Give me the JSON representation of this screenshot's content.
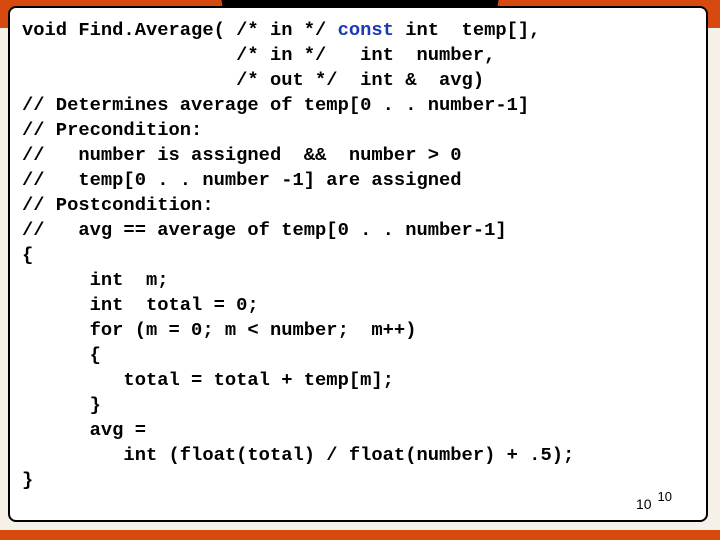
{
  "code": {
    "l1a": "void Find.Average( /* in */ ",
    "l1b": "const",
    "l1c": " int  temp[],",
    "l2": "                   /* in */   int  number,",
    "l3": "                   /* out */  int &  avg)",
    "l4": "// Determines average of temp[0 . . number-1]",
    "l5": "// Precondition:",
    "l6": "//   number is assigned  &&  number > 0",
    "l7": "//   temp[0 . . number -1] are assigned",
    "l8": "// Postcondition:",
    "l9": "//   avg == average of temp[0 . . number-1]",
    "l10": "{",
    "l11": "      int  m;",
    "l12": "      int  total = 0;",
    "l13": "      for (m = 0; m < number;  m++)",
    "l14": "      {",
    "l15": "         total = total + temp[m];",
    "l16": "      }",
    "l17": "      avg =",
    "l18": "         int (float(total) / float(number) + .5);",
    "l19": "}"
  },
  "page": {
    "number": "10",
    "small": "10"
  }
}
